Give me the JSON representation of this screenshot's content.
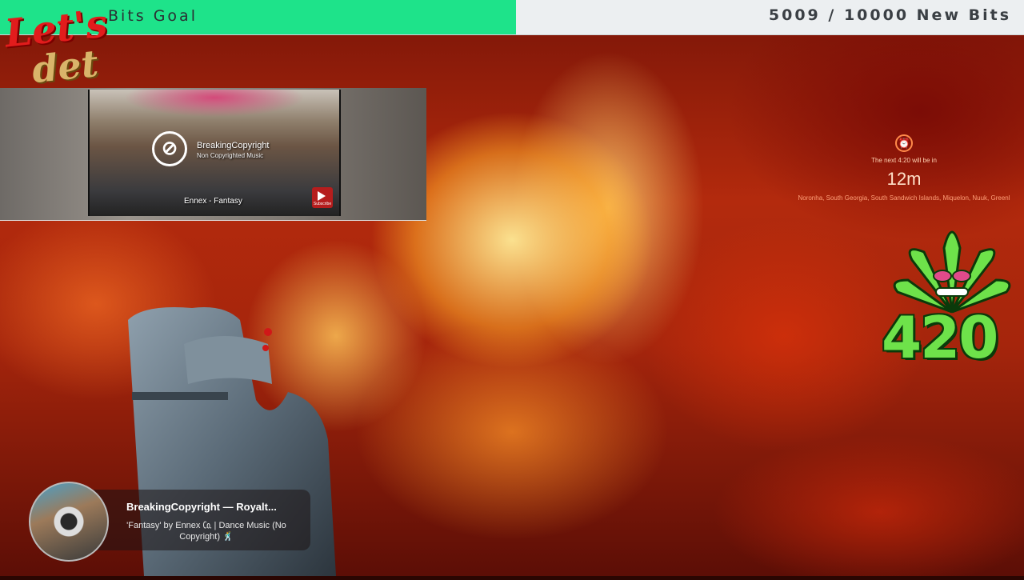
{
  "goal": {
    "title": "Bits Goal",
    "current": 5009,
    "target": 10000,
    "progress_text": "5009 / 10000 New Bits",
    "fill_fraction": 0.5009,
    "fill_color": "#1ee38a"
  },
  "logo": {
    "line1": "Let's",
    "line2": "det"
  },
  "video": {
    "channel": "BreakingCopyright",
    "channel_sub": "Non Copyrighted Music",
    "track": "Ennex - Fantasy",
    "subscribe_label": "Subscribe"
  },
  "timer": {
    "icon": "alarm-clock-icon",
    "label": "The next 4:20 will be in",
    "value": "12m",
    "regions": "Noronha, South Georgia, South Sandwich Islands, Miquelon, Nuuk, Greenl"
  },
  "badge": {
    "text": "420",
    "color": "#6ee24a"
  },
  "now_playing": {
    "title": "BreakingCopyright — Royalt...",
    "subtitle": "'Fantasy' by Ennex ㏇ | Dance Music (No Copyright) 🕺"
  }
}
